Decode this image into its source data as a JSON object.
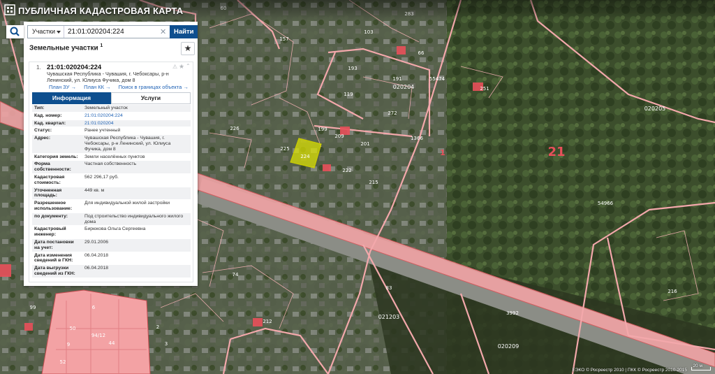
{
  "app": {
    "title": "ПУБЛИЧНАЯ КАДАСТРОВАЯ КАРТА"
  },
  "search": {
    "type": "Участки",
    "value": "21:01:020204:224",
    "button": "Найти"
  },
  "panel": {
    "title": "Земельные участки",
    "count": "1",
    "item": {
      "num": "1.",
      "id": "21:01:020204:224",
      "address": "Чувашская Республика - Чувашия, г. Чебоксары, р-н Ленинский, ул. Юлиуса Фучика, дом 8",
      "links": [
        "План ЗУ →",
        "План КК →",
        "Поиск в границах объекта →"
      ]
    },
    "tabs": [
      "Информация",
      "Услуги"
    ],
    "attributes": [
      {
        "k": "Тип:",
        "v": "Земельный участок"
      },
      {
        "k": "Кад. номер:",
        "v": "21:01:020204:224"
      },
      {
        "k": "Кад. квартал:",
        "v": "21:01:020204"
      },
      {
        "k": "Статус:",
        "v": "Ранее учтенный"
      },
      {
        "k": "Адрес:",
        "v": "Чувашская Республика - Чувашия, г. Чебоксары, р-н Ленинский, ул. Юлиуса Фучика, дом 8"
      },
      {
        "k": "Категория земель:",
        "v": "Земли населённых пунктов"
      },
      {
        "k": "Форма собственности:",
        "v": "Частная собственность"
      },
      {
        "k": "Кадастровая стоимость:",
        "v": "562 296,17 руб."
      },
      {
        "k": "Уточненная площадь:",
        "v": "449 кв. м"
      },
      {
        "k": "Разрешенное использование:",
        "v": "Для индивидуальной жилой застройки"
      },
      {
        "k": "по документу:",
        "v": "Под строительство индивидуального жилого дома"
      },
      {
        "k": "Кадастровый инженер:",
        "v": "Бирюкова Ольга Сергеевна"
      },
      {
        "k": "Дата постановки на учет:",
        "v": "29.01.2006"
      },
      {
        "k": "Дата изменения сведений в ГКН:",
        "v": "06.04.2018"
      },
      {
        "k": "Дата выгрузки сведений из ГКН:",
        "v": "06.04.2018"
      }
    ]
  },
  "map": {
    "labels": [
      {
        "t": "21"
      },
      {
        "t": "1"
      },
      {
        "t": "020204"
      },
      {
        "t": "020205"
      },
      {
        "t": "021203"
      },
      {
        "t": "020209"
      },
      {
        "t": "224"
      },
      {
        "t": "199"
      },
      {
        "t": "209"
      },
      {
        "t": "201"
      },
      {
        "t": "225"
      },
      {
        "t": "222"
      },
      {
        "t": "215"
      },
      {
        "t": "119"
      },
      {
        "t": "272"
      },
      {
        "t": "191"
      },
      {
        "t": "193"
      },
      {
        "t": "1366"
      },
      {
        "t": "55474"
      },
      {
        "t": "54966"
      },
      {
        "t": "3992"
      },
      {
        "t": "226"
      },
      {
        "t": "283"
      },
      {
        "t": "251"
      },
      {
        "t": "157"
      },
      {
        "t": "103"
      },
      {
        "t": "66"
      },
      {
        "t": "60"
      },
      {
        "t": "50"
      },
      {
        "t": "44"
      },
      {
        "t": "52"
      },
      {
        "t": "6"
      },
      {
        "t": "9"
      },
      {
        "t": "99"
      },
      {
        "t": "74"
      },
      {
        "t": "83"
      },
      {
        "t": "212"
      },
      {
        "t": "216"
      },
      {
        "t": "2"
      },
      {
        "t": "3"
      },
      {
        "t": "94/12"
      }
    ]
  },
  "footer": {
    "copyright": "ЕЭКО © Росреестр 2010 | ПКК © Росреестр 2010-2015",
    "scale": "20 м"
  },
  "colors": {
    "accent": "#0e4f8f",
    "parcel": "#f2a0a4",
    "selected": "#e3e800"
  }
}
